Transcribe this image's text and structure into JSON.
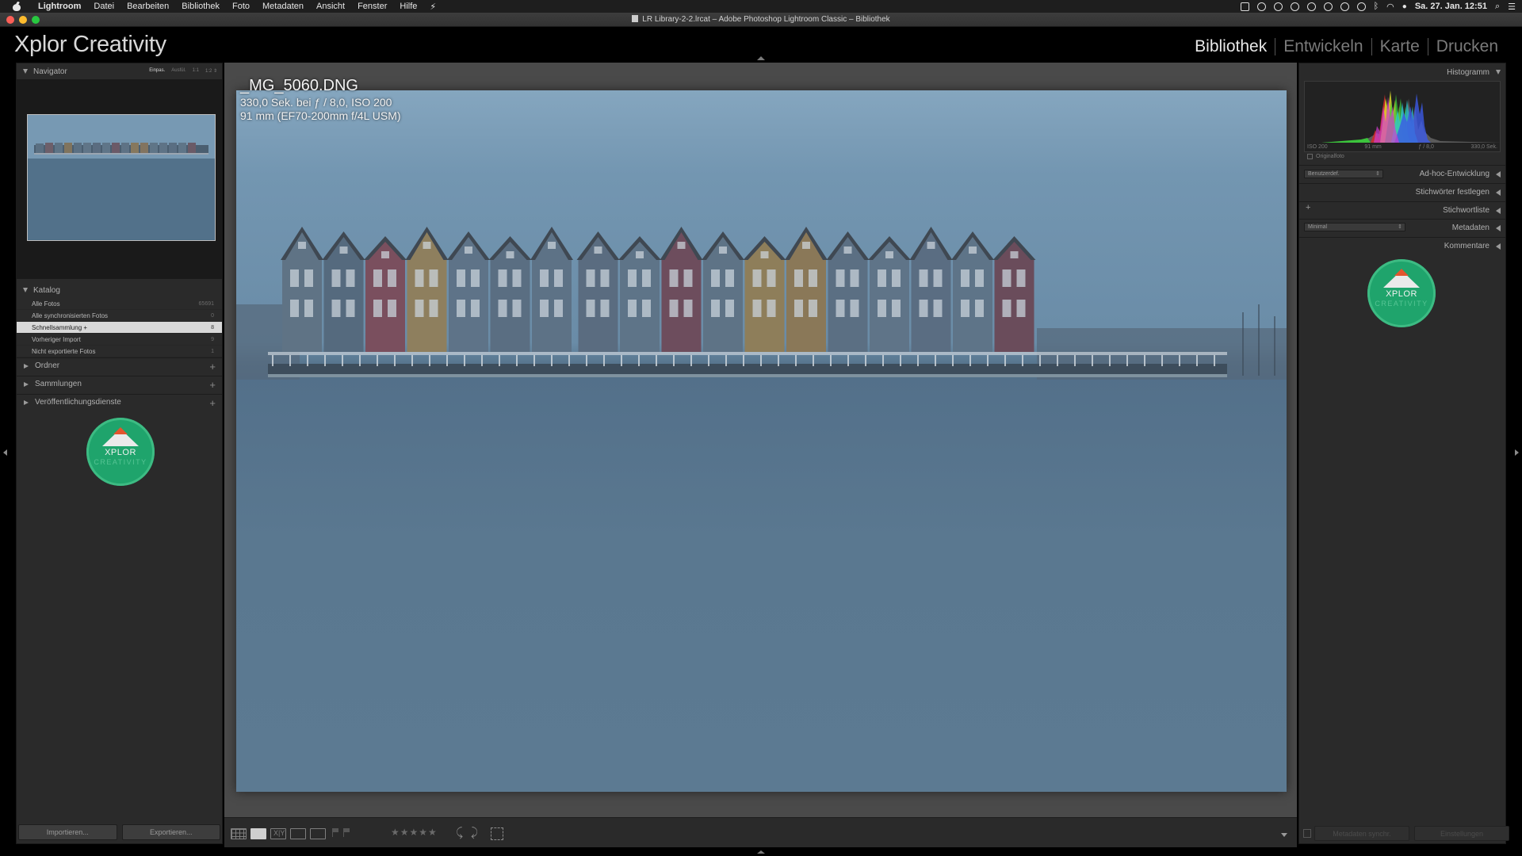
{
  "menubar": {
    "app_name": "Lightroom",
    "items": [
      "Datei",
      "Bearbeiten",
      "Bibliothek",
      "Foto",
      "Metadaten",
      "Ansicht",
      "Fenster",
      "Hilfe"
    ],
    "clock": "Sa. 27. Jan.  12:51"
  },
  "window": {
    "title": "LR Library-2-2.lrcat – Adobe Photoshop Lightroom Classic – Bibliothek"
  },
  "identity_plate": "Xplor Creativity",
  "modules": {
    "items": [
      "Bibliothek",
      "Entwickeln",
      "Karte",
      "Drucken"
    ],
    "active": "Bibliothek"
  },
  "left_panel": {
    "navigator": {
      "title": "Navigator",
      "zoom_options": [
        "Einpas.",
        "Ausfül.",
        "1:1",
        "1:2 ⇕"
      ],
      "active_zoom": "Einpas."
    },
    "katalog": {
      "title": "Katalog",
      "rows": [
        {
          "label": "Alle Fotos",
          "count": "65691"
        },
        {
          "label": "Alle synchronisierten Fotos",
          "count": "0"
        },
        {
          "label": "Schnellsammlung +",
          "count": "8"
        },
        {
          "label": "Vorheriger Import",
          "count": "9"
        },
        {
          "label": "Nicht exportierte Fotos",
          "count": "1"
        }
      ],
      "selected_index": 2
    },
    "sections": [
      {
        "label": "Ordner",
        "add": "+"
      },
      {
        "label": "Sammlungen",
        "add": "+"
      },
      {
        "label": "Veröffentlichungsdienste",
        "add": "+"
      }
    ],
    "import_button": "Importieren...",
    "export_button": "Exportieren..."
  },
  "logo": {
    "line1": "XPLOR",
    "line2": "CREATIVITY"
  },
  "photo_info": {
    "filename": "_MG_5060.DNG",
    "exposure": "330,0 Sek. bei ƒ / 8,0, ISO 200",
    "lens": "91 mm (EF70-200mm f/4L USM)"
  },
  "toolbar": {
    "stars": "★★★★★"
  },
  "right_panel": {
    "histogram": {
      "title": "Histogramm",
      "iso": "ISO 200",
      "focal": "91 mm",
      "aperture": "ƒ / 8,0",
      "shutter": "330,0 Sek.",
      "original_label": "Originalfoto"
    },
    "quick_develop": {
      "title": "Ad-hoc-Entwicklung",
      "preset": "Benutzerdef."
    },
    "keywording": {
      "title": "Stichwörter festlegen"
    },
    "keyword_list": {
      "title": "Stichwortliste",
      "add": "+"
    },
    "metadata": {
      "title": "Metadaten",
      "preset": "Minimal"
    },
    "comments": {
      "title": "Kommentare"
    },
    "sync_metadata_button": "Metadaten synchr.",
    "sync_settings_button": "Einstellungen"
  },
  "colors": {
    "accent_green": "#1fa46c",
    "selected_row": "#d8d8d8",
    "panel_bg": "#2a2a2a"
  }
}
